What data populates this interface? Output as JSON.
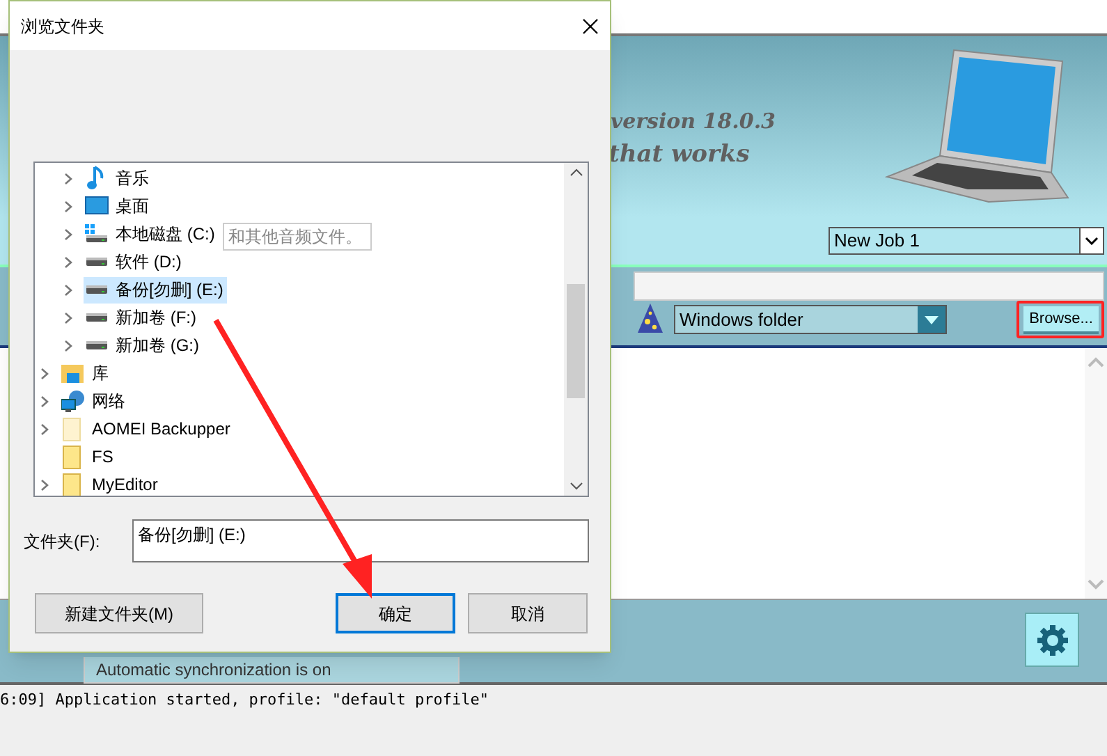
{
  "app": {
    "version": "version 18.0.3",
    "tagline": "that works",
    "job_select": {
      "value": "New Job 1"
    },
    "source_select": {
      "value": "Windows folder"
    },
    "browse_button": {
      "label": "Browse...",
      "highlighted": true
    },
    "status_text": "Automatic synchronization is on",
    "log": [
      "6:09] Application started, profile: \"default profile\""
    ]
  },
  "dialog": {
    "title": "浏览文件夹",
    "tooltip": "和其他音频文件。",
    "tree": [
      {
        "children": [
          {
            "label": "音乐",
            "kind": "music",
            "expandable": true,
            "selected": false
          },
          {
            "label": "桌面",
            "kind": "desktop",
            "expandable": true,
            "selected": false
          },
          {
            "label": "本地磁盘 (C:)",
            "kind": "system-drive",
            "expandable": true,
            "selected": false
          },
          {
            "label": "软件 (D:)",
            "kind": "drive",
            "expandable": true,
            "selected": false
          },
          {
            "label": "备份[勿删] (E:)",
            "kind": "drive",
            "expandable": true,
            "selected": true
          },
          {
            "label": "新加卷 (F:)",
            "kind": "drive",
            "expandable": true,
            "selected": false
          },
          {
            "label": "新加卷 (G:)",
            "kind": "drive",
            "expandable": true,
            "selected": false
          }
        ]
      },
      {
        "label": "库",
        "kind": "library",
        "expandable": true,
        "selected": false
      },
      {
        "label": "网络",
        "kind": "network",
        "expandable": true,
        "selected": false
      },
      {
        "label": "AOMEI Backupper",
        "kind": "folder-pale",
        "expandable": true,
        "selected": false
      },
      {
        "label": "FS",
        "kind": "folder",
        "expandable": false,
        "selected": false
      },
      {
        "label": "MyEditor",
        "kind": "folder",
        "expandable": true,
        "selected": false
      }
    ],
    "folder_field": {
      "label": "文件夹(F):",
      "value": "备份[勿删] (E:)"
    },
    "buttons": [
      {
        "label": "新建文件夹(M)",
        "default": false
      },
      {
        "label": "确定",
        "default": true
      },
      {
        "label": "取消",
        "default": false
      }
    ]
  }
}
